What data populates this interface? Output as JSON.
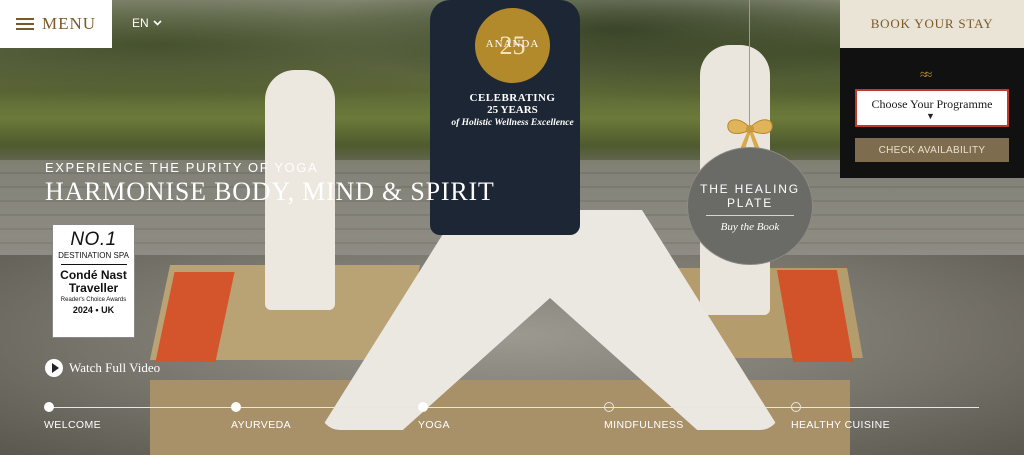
{
  "header": {
    "menu_label": "MENU",
    "language": "EN",
    "book_stay_label": "BOOK YOUR STAY"
  },
  "logo": {
    "number": "25",
    "brand": "ANANDA",
    "line1": "CELEBRATING",
    "line2": "25 YEARS",
    "line3": "of Holistic Wellness Excellence"
  },
  "booking": {
    "programme_select_value": "Choose Your Programme",
    "check_availability_label": "CHECK AVAILABILITY"
  },
  "healing_plate": {
    "line1": "THE HEALING",
    "line2": "PLATE",
    "link": "Buy the Book"
  },
  "hero": {
    "eyebrow": "EXPERIENCE THE PURITY OF YOGA",
    "headline": "HARMONISE BODY, MIND & SPIRIT"
  },
  "award": {
    "rank": "NO.1",
    "category": "DESTINATION SPA",
    "publication_line1": "Condé Nast",
    "publication_line2": "Traveller",
    "award_name": "Reader's Choice Awards",
    "year_region": "2024 • UK"
  },
  "video": {
    "label": "Watch Full Video"
  },
  "nav": {
    "items": [
      {
        "label": "WELCOME",
        "active": true
      },
      {
        "label": "AYURVEDA",
        "active": true
      },
      {
        "label": "YOGA",
        "active": true
      },
      {
        "label": "MINDFULNESS",
        "active": false
      },
      {
        "label": "HEALTHY CUISINE",
        "active": false
      }
    ]
  },
  "colors": {
    "gold": "#b28a2c",
    "brown_text": "#7a5a2a",
    "panel_bg": "#111111",
    "select_border": "#c0392b",
    "check_btn": "#7e6c4e"
  }
}
